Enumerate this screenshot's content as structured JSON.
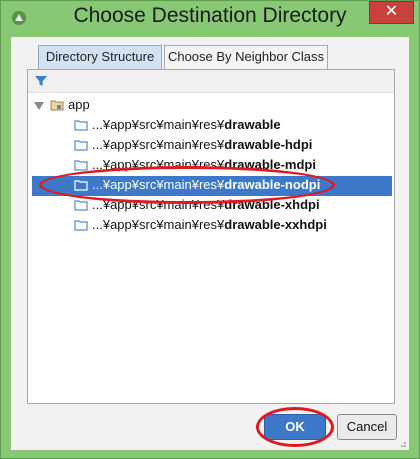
{
  "window": {
    "title": "Choose Destination Directory",
    "close_label": "✕"
  },
  "tabs": [
    {
      "label": "Directory Structure",
      "active": true
    },
    {
      "label": "Choose By Neighbor Class",
      "active": false
    }
  ],
  "tree": {
    "root": {
      "label": "app"
    },
    "items": [
      {
        "prefix": "...¥app¥src¥main¥res¥",
        "name": "drawable",
        "selected": false
      },
      {
        "prefix": "...¥app¥src¥main¥res¥",
        "name": "drawable-hdpi",
        "selected": false
      },
      {
        "prefix": "...¥app¥src¥main¥res¥",
        "name": "drawable-mdpi",
        "selected": false
      },
      {
        "prefix": "...¥app¥src¥main¥res¥",
        "name": "drawable-nodpi",
        "selected": true
      },
      {
        "prefix": "...¥app¥src¥main¥res¥",
        "name": "drawable-xhdpi",
        "selected": false
      },
      {
        "prefix": "...¥app¥src¥main¥res¥",
        "name": "drawable-xxhdpi",
        "selected": false
      }
    ]
  },
  "buttons": {
    "ok_label": "OK",
    "cancel_label": "Cancel"
  },
  "colors": {
    "titlebar": "#86c873",
    "selection": "#3d78c9",
    "annotation": "#e0191f",
    "close": "#c7413e"
  }
}
